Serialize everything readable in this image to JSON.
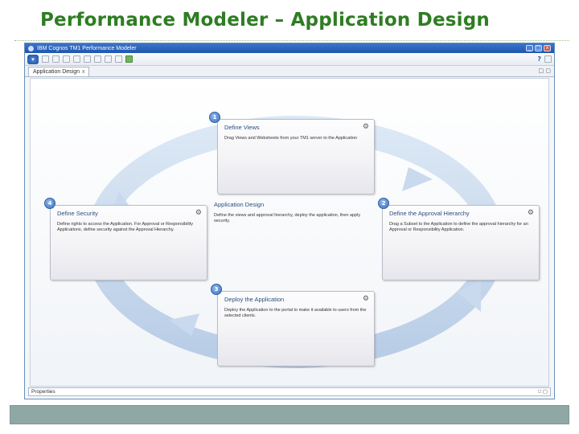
{
  "slide": {
    "title": "Performance Modeler – Application Design"
  },
  "window": {
    "title": "IBM Cognos TM1 Performance Modeler",
    "minimize": "_",
    "maximize": "□",
    "close": "x"
  },
  "toolbar": {
    "help_label": "?"
  },
  "tab": {
    "label": "Application Design",
    "close": "x",
    "controls": "□ ▢"
  },
  "steps": [
    {
      "number": "1",
      "title": "Define Views",
      "description": "Drag Views and Websheets from your TM1 server to the Application"
    },
    {
      "number": "2",
      "title": "Define the Approval Hierarchy",
      "description": "Drag a Subset to the Application to define the approval hierarchy for an Approval or Responsibility Application."
    },
    {
      "number": "3",
      "title": "Deploy the Application",
      "description": "Deploy the Application to the portal to make it available to users from the selected clients."
    },
    {
      "number": "4",
      "title": "Define Security",
      "description": "Define rights to access the Application. For Approval or Responsibility Applications, define security against the Approval Hierarchy."
    }
  ],
  "center": {
    "title": "Application Design",
    "description": "Define the views and approval hierarchy, deploy the application, then apply security."
  },
  "properties": {
    "label": "Properties",
    "controls": "□ ▢"
  },
  "colors": {
    "title_green": "#2e7d22",
    "arrow_blue": "#c9daee",
    "badge_blue": "#3a72c4",
    "footer": "#8fa8a6"
  }
}
